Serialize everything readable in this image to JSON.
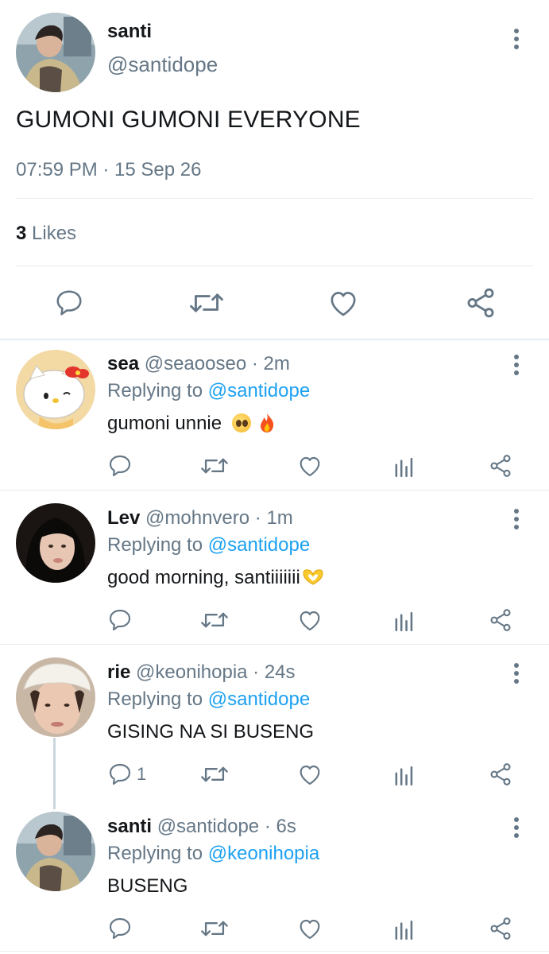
{
  "main_tweet": {
    "name": "santi",
    "handle": "@santidope",
    "text": "GUMONI GUMONI EVERYONE",
    "timestamp": "07:59 PM · 15 Sep 26",
    "likes_count": "3",
    "likes_label": "Likes"
  },
  "replies": [
    {
      "name": "sea",
      "handle": "@seaooseo",
      "time": "· 2m",
      "replying_label": "Replying to",
      "replying_to": "@santidope",
      "text": "gumoni unnie",
      "reply_count": ""
    },
    {
      "name": "Lev",
      "handle": "@mohnvero",
      "time": "· 1m",
      "replying_label": "Replying to",
      "replying_to": "@santidope",
      "text": "good morning, santiiiiiii",
      "reply_count": ""
    },
    {
      "name": "rie",
      "handle": "@keonihopia",
      "time": "· 24s",
      "replying_label": "Replying to",
      "replying_to": "@santidope",
      "text": "GISING NA SI BUSENG",
      "reply_count": "1"
    },
    {
      "name": "santi",
      "handle": "@santidope",
      "time": "· 6s",
      "replying_label": "Replying to",
      "replying_to": "@keonihopia",
      "text": "BUSENG",
      "reply_count": ""
    }
  ],
  "colors": {
    "accent": "#1da1f2",
    "muted": "#657786",
    "divider": "#e6ecf0"
  },
  "icons": [
    "more-vert-icon",
    "reply-icon",
    "retweet-icon",
    "like-icon",
    "analytics-icon",
    "share-icon"
  ]
}
